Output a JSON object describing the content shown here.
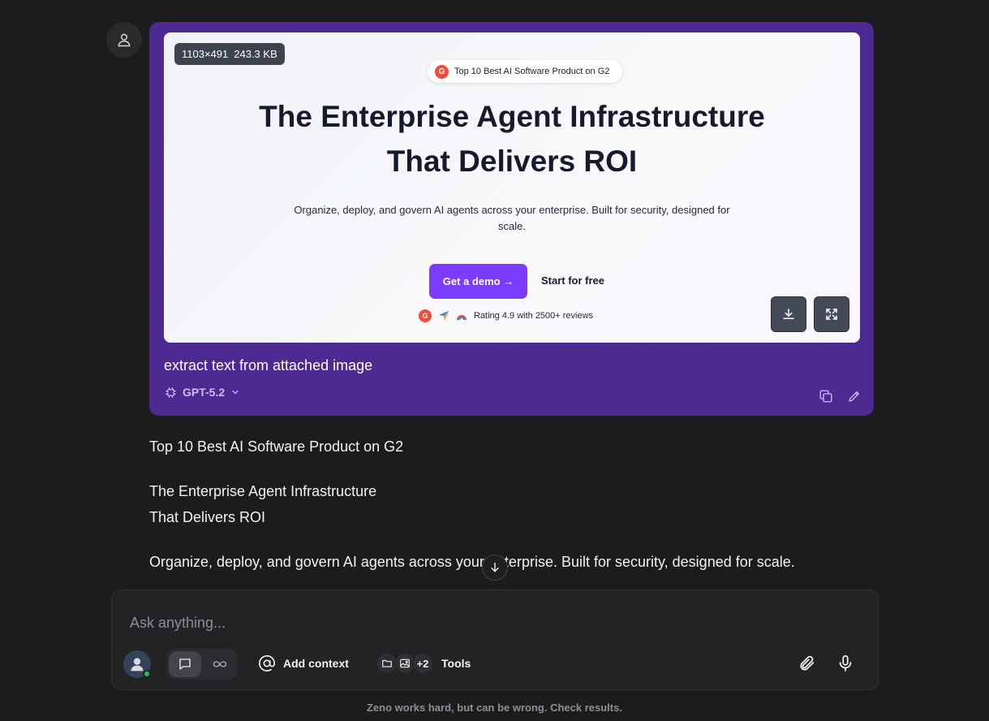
{
  "message": {
    "image_meta": {
      "dimensions": "1103×491",
      "size": "243.3 KB"
    },
    "image_content": {
      "badge": "Top 10 Best AI Software Product on G2",
      "badge_logo": "G",
      "title_line1": "The Enterprise Agent Infrastructure",
      "title_line2": "That Delivers ROI",
      "subtitle_line1": "Organize, deploy, and govern AI agents across your enterprise. Built for security, designed for",
      "subtitle_line2": "scale.",
      "primary_cta": "Get a demo →",
      "secondary_cta": "Start for free",
      "rating": "Rating 4.9 with 2500+ reviews",
      "brand_color": "#7b3cff"
    },
    "prompt": "extract text from attached image",
    "model": "GPT-5.2",
    "bubble_color": "#4c2a91",
    "icons": [
      "user-icon",
      "download-icon",
      "expand-icon",
      "chip-icon",
      "chevron-down-icon",
      "copy-icon",
      "edit-icon"
    ]
  },
  "response": {
    "lines": [
      "Top 10 Best AI Software Product on G2",
      "The Enterprise Agent Infrastructure",
      "That Delivers ROI",
      "Organize, deploy, and govern AI agents across your enterprise. Built for security, designed for scale."
    ]
  },
  "composer": {
    "placeholder": "Ask anything...",
    "add_context": "Add context",
    "tools_count": "+2",
    "tools_label": "Tools",
    "online_color": "#2fbf5b",
    "icons": [
      "avatar-icon",
      "chat-mode-icon",
      "infinity-icon",
      "at-icon",
      "folder-icon",
      "image-icon",
      "paperclip-icon",
      "microphone-icon",
      "arrow-down-icon"
    ]
  },
  "disclaimer": "Zeno works hard, but can be wrong. Check results."
}
